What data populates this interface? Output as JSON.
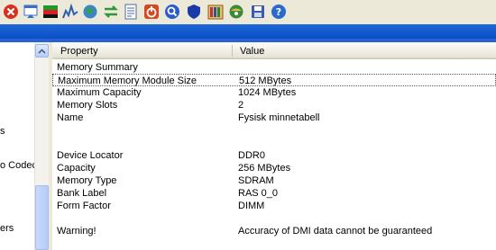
{
  "toolbar": {
    "buttons": [
      {
        "icon": "close-icon",
        "color": "#d83020"
      },
      {
        "icon": "properties-icon",
        "color": "#3a6fc8"
      },
      {
        "icon": "color-bars-icon",
        "color": "#1b9a2a"
      },
      {
        "icon": "graph-icon",
        "color": "#2b5fb0"
      },
      {
        "icon": "globe-icon",
        "color": "#3a86c9"
      },
      {
        "icon": "refresh-arrows-icon",
        "color": "#2a9a3a"
      },
      {
        "icon": "document-icon",
        "color": "#4a6aa8"
      },
      {
        "icon": "power-icon",
        "color": "#d84820"
      },
      {
        "icon": "search-icon",
        "color": "#2a5ad0"
      },
      {
        "icon": "shield-icon",
        "color": "#1a3aa8"
      },
      {
        "icon": "library-icon",
        "color": "#c08a30"
      },
      {
        "icon": "globe-info-icon",
        "color": "#3a8a3a"
      },
      {
        "icon": "save-icon",
        "color": "#3a5ab0"
      },
      {
        "icon": "help-icon",
        "color": "#2a6ad0"
      }
    ]
  },
  "tree": {
    "fragments": [
      "s",
      "o Codec",
      "ers"
    ]
  },
  "list": {
    "columns": {
      "property": "Property",
      "value": "Value"
    },
    "rows": [
      {
        "property": "Memory Summary",
        "value": ""
      },
      {
        "property": "Maximum Memory Module Size",
        "value": "512 MBytes",
        "selected": true
      },
      {
        "property": "Maximum Capacity",
        "value": "1024 MBytes"
      },
      {
        "property": "Memory Slots",
        "value": "2"
      },
      {
        "property": "Name",
        "value": "Fysisk minnetabell"
      },
      {
        "property": "",
        "value": ""
      },
      {
        "property": "",
        "value": ""
      },
      {
        "property": "Device Locator",
        "value": "DDR0"
      },
      {
        "property": "Capacity",
        "value": "256 MBytes"
      },
      {
        "property": "Memory Type",
        "value": "SDRAM"
      },
      {
        "property": "Bank Label",
        "value": "RAS 0_0"
      },
      {
        "property": "Form Factor",
        "value": "DIMM"
      },
      {
        "property": "",
        "value": ""
      },
      {
        "property": "Warning!",
        "value": "Accuracy of DMI data cannot be guaranteed"
      }
    ]
  }
}
